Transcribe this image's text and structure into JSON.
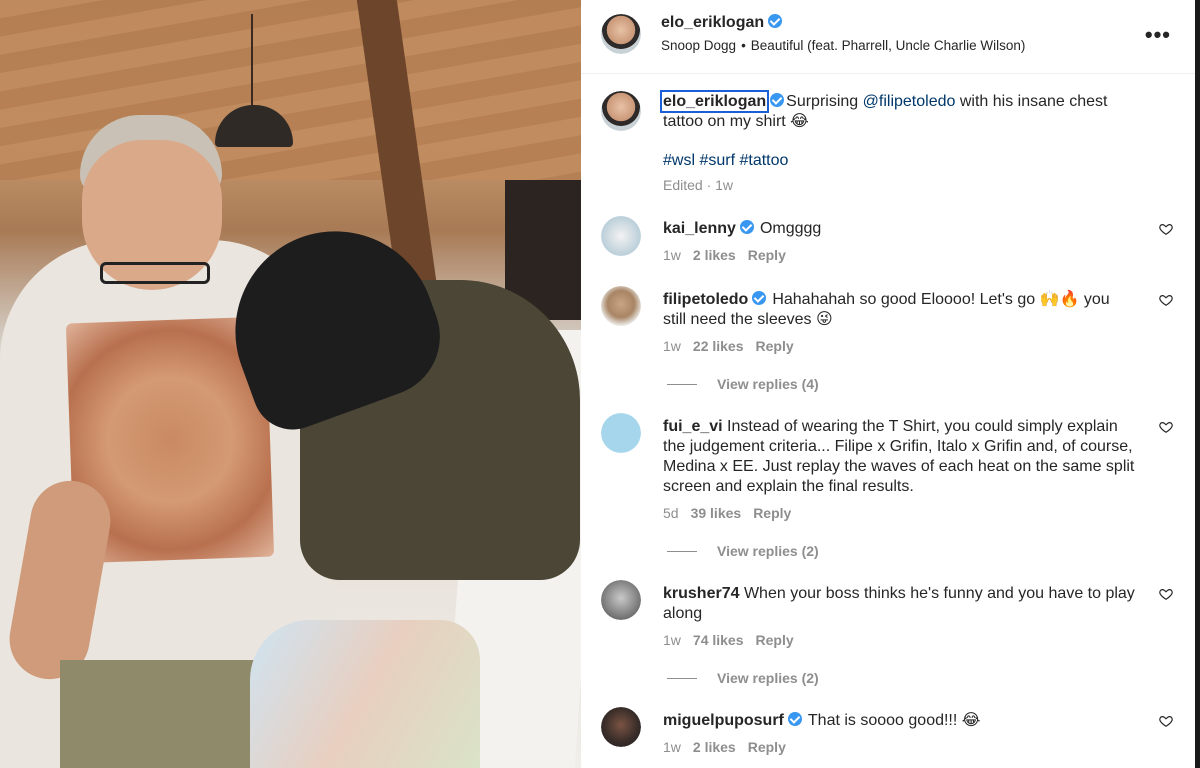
{
  "post": {
    "author": "elo_eriklogan",
    "audio_artist": "Snoop Dogg",
    "audio_track": "Beautiful (feat. Pharrell, Uncle Charlie Wilson)",
    "audio_separator": "•",
    "more_label": "•••"
  },
  "caption": {
    "username": "elo_eriklogan",
    "text_before": "Surprising ",
    "mention": "@filipetoledo",
    "text_after": " with his insane chest tattoo on my shirt 😂",
    "hashtags": "#wsl #surf #tattoo",
    "meta": "Edited · 1w"
  },
  "comments": [
    {
      "username": "kai_lenny",
      "verified": true,
      "text": "Omgggg",
      "time": "1w",
      "likes": "2 likes",
      "reply": "Reply",
      "view_replies": "",
      "avatar_color": "#9ec3d6"
    },
    {
      "username": "filipetoledo",
      "verified": true,
      "text": "Hahahahah so good Eloooo! Let's go 🙌🔥 you still need the sleeves 😜",
      "time": "1w",
      "likes": "22 likes",
      "reply": "Reply",
      "view_replies": "View replies (4)",
      "avatar_color": "#b9a48a"
    },
    {
      "username": "fui_e_vi",
      "verified": false,
      "text": "Instead of wearing the T Shirt, you could simply explain the judgement criteria... Filipe x Grifin, Italo x Grifin and, of course, Medina x EE. Just replay the waves of each heat on the same split screen and explain the final results.",
      "time": "5d",
      "likes": "39 likes",
      "reply": "Reply",
      "view_replies": "View replies (2)",
      "avatar_color": "#a6d6ec"
    },
    {
      "username": "krusher74",
      "verified": false,
      "text": "When your boss thinks he's funny and you have to play along",
      "time": "1w",
      "likes": "74 likes",
      "reply": "Reply",
      "view_replies": "View replies (2)",
      "avatar_color": "#6d6d6d"
    },
    {
      "username": "miguelpuposurf",
      "verified": true,
      "text": "That is soooo good!!! 😂",
      "time": "1w",
      "likes": "2 likes",
      "reply": "Reply",
      "view_replies": "",
      "avatar_color": "#3b2e2a"
    }
  ],
  "colors": {
    "link": "#00376b",
    "verified": "#3897f0",
    "muted": "#8e8e8e"
  },
  "icons": {
    "verified": "verified-badge-icon",
    "like": "heart-icon",
    "more": "more-options-icon"
  }
}
